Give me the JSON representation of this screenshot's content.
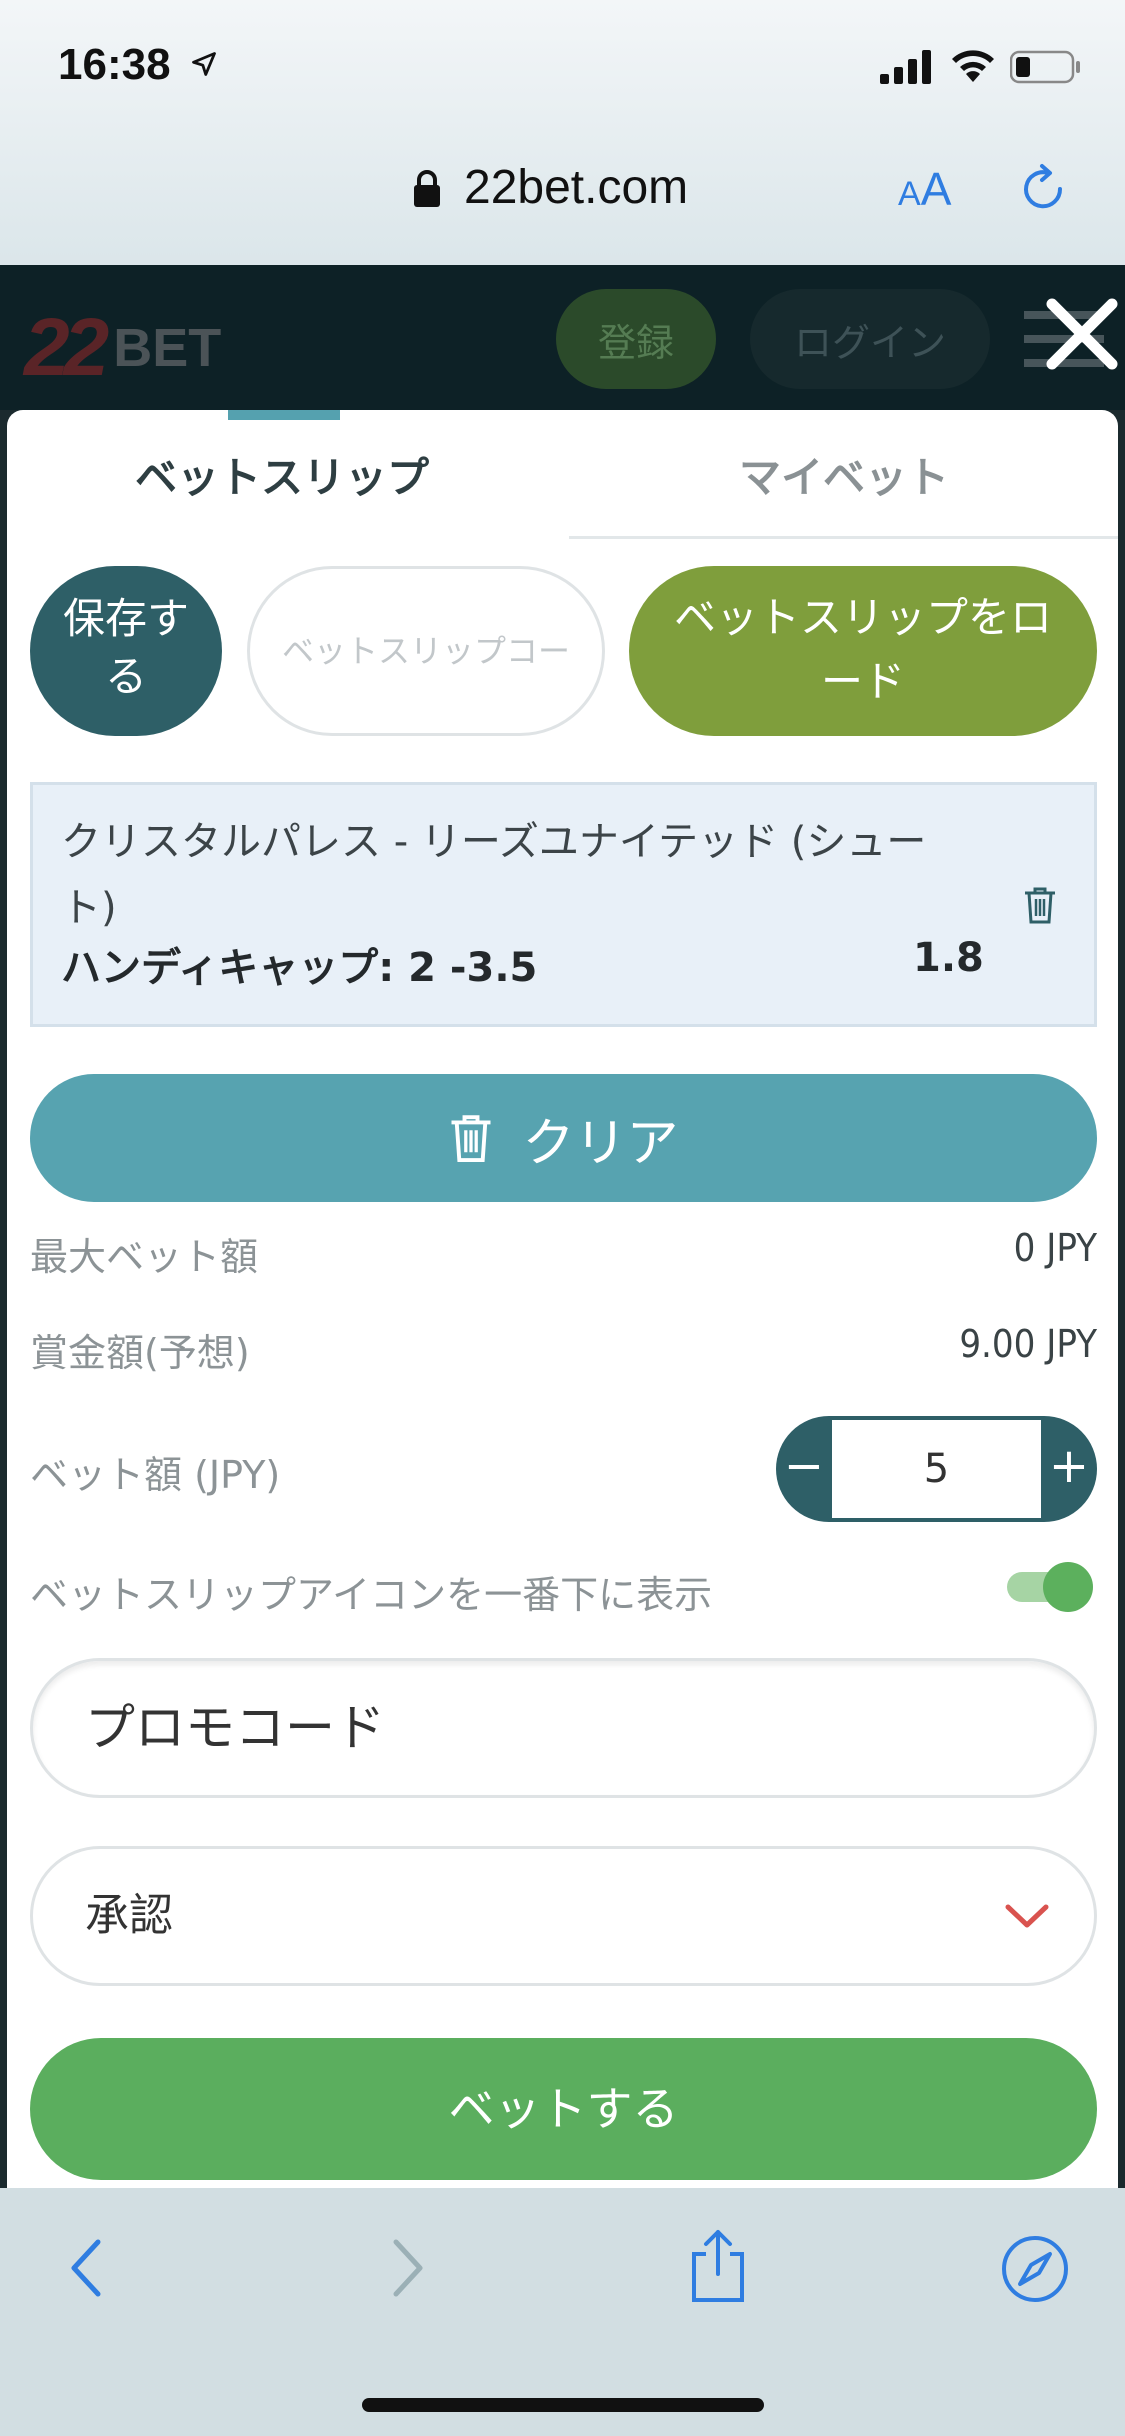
{
  "status_bar": {
    "time": "16:38"
  },
  "browser": {
    "url": "22bet.com",
    "aa_label_small": "A",
    "aa_label_large": "A"
  },
  "site_header": {
    "logo_number": "22",
    "logo_word": "BET",
    "register_label": "登録",
    "login_label": "ログイン"
  },
  "tabs": [
    {
      "label": "ベットスリップ",
      "active": true
    },
    {
      "label": "マイベット",
      "active": false
    }
  ],
  "actions": {
    "save_label_line1": "保存す",
    "save_label_line2": "る",
    "code_placeholder": "ベットスリップコー",
    "load_label_line1": "ベットスリップをロ",
    "load_label_line2": "ード"
  },
  "bet": {
    "match": "クリスタルパレス - リーズユナイテッド (シュート)",
    "market": "ハンディキャップ: 2 -3.5",
    "odds": "1.8"
  },
  "clear_label": "クリア",
  "summary": {
    "max_bet_label": "最大ベット額",
    "max_bet_value": "0 JPY",
    "winnings_label": "賞金額(予想)",
    "winnings_value": "9.00 JPY",
    "stake_label": "ベット額 (JPY)",
    "stake_value": "5",
    "stake_minus": "−",
    "stake_plus": "+"
  },
  "toggle_row": {
    "label": "ベットスリップアイコンを一番下に表示",
    "on": true
  },
  "promo_placeholder": "プロモコード",
  "accept_select_value": "承認",
  "place_bet_label": "ベットする",
  "colors": {
    "brand_teal": "#2e5f67",
    "clear_blue": "#57a3b0",
    "load_olive": "#7f9e3c",
    "bet_green": "#5bae5e",
    "chevron_red": "#d9534f"
  }
}
